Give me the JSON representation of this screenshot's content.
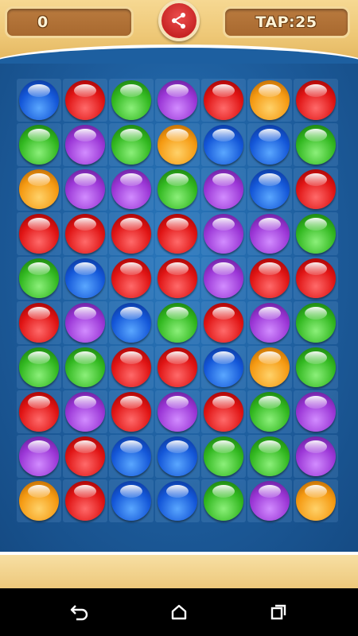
{
  "header": {
    "score": "0",
    "taps": "TAP:25"
  },
  "share": {
    "icon": "share-icon"
  },
  "board": {
    "rows": [
      [
        "blue",
        "red",
        "green",
        "purple",
        "red",
        "orange",
        "red"
      ],
      [
        "green",
        "purple",
        "green",
        "orange",
        "blue",
        "blue",
        "green"
      ],
      [
        "orange",
        "purple",
        "purple",
        "green",
        "purple",
        "blue",
        "red"
      ],
      [
        "red",
        "red",
        "red",
        "red",
        "purple",
        "purple",
        "green"
      ],
      [
        "green",
        "blue",
        "red",
        "red",
        "purple",
        "red",
        "red"
      ],
      [
        "red",
        "purple",
        "blue",
        "green",
        "red",
        "purple",
        "green"
      ],
      [
        "green",
        "green",
        "red",
        "red",
        "blue",
        "orange",
        "green"
      ],
      [
        "red",
        "purple",
        "red",
        "purple",
        "red",
        "green",
        "purple"
      ],
      [
        "purple",
        "red",
        "blue",
        "blue",
        "green",
        "green",
        "purple"
      ],
      [
        "orange",
        "red",
        "blue",
        "blue",
        "green",
        "purple",
        "orange"
      ]
    ]
  },
  "nav": {
    "back_icon": "back-icon",
    "home_icon": "home-icon",
    "recents_icon": "recents-icon"
  }
}
